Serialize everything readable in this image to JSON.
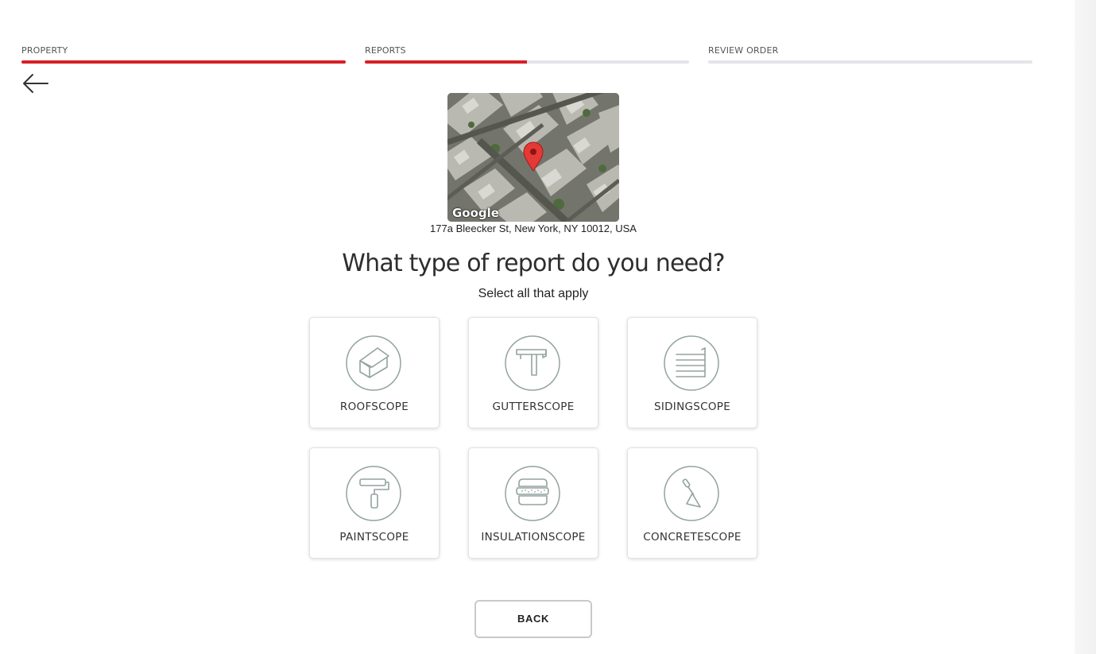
{
  "stepper": {
    "steps": [
      {
        "label": "PROPERTY",
        "progress": 1.0
      },
      {
        "label": "REPORTS",
        "progress": 0.5
      },
      {
        "label": "REVIEW ORDER",
        "progress": 0.0
      }
    ],
    "active_color": "#d71f26",
    "track_color": "#e3e5ea"
  },
  "nav": {
    "back_icon": "arrow-left-icon"
  },
  "map": {
    "attribution": "Google",
    "marker_icon": "map-pin-icon",
    "marker_color": "#e53935"
  },
  "address": "177a Bleecker St, New York, NY 10012, USA",
  "heading": "What type of report do you need?",
  "subheading": "Select all that apply",
  "reports": [
    {
      "label": "ROOFSCOPE",
      "icon": "house-roof-icon"
    },
    {
      "label": "GUTTERSCOPE",
      "icon": "gutter-icon"
    },
    {
      "label": "SIDINGSCOPE",
      "icon": "siding-icon"
    },
    {
      "label": "PAINTSCOPE",
      "icon": "paint-roller-icon"
    },
    {
      "label": "INSULATIONSCOPE",
      "icon": "insulation-icon"
    },
    {
      "label": "CONCRETESCOPE",
      "icon": "trowel-icon"
    }
  ],
  "icon_color": "#93a3a1",
  "back_button": {
    "label": "BACK"
  }
}
